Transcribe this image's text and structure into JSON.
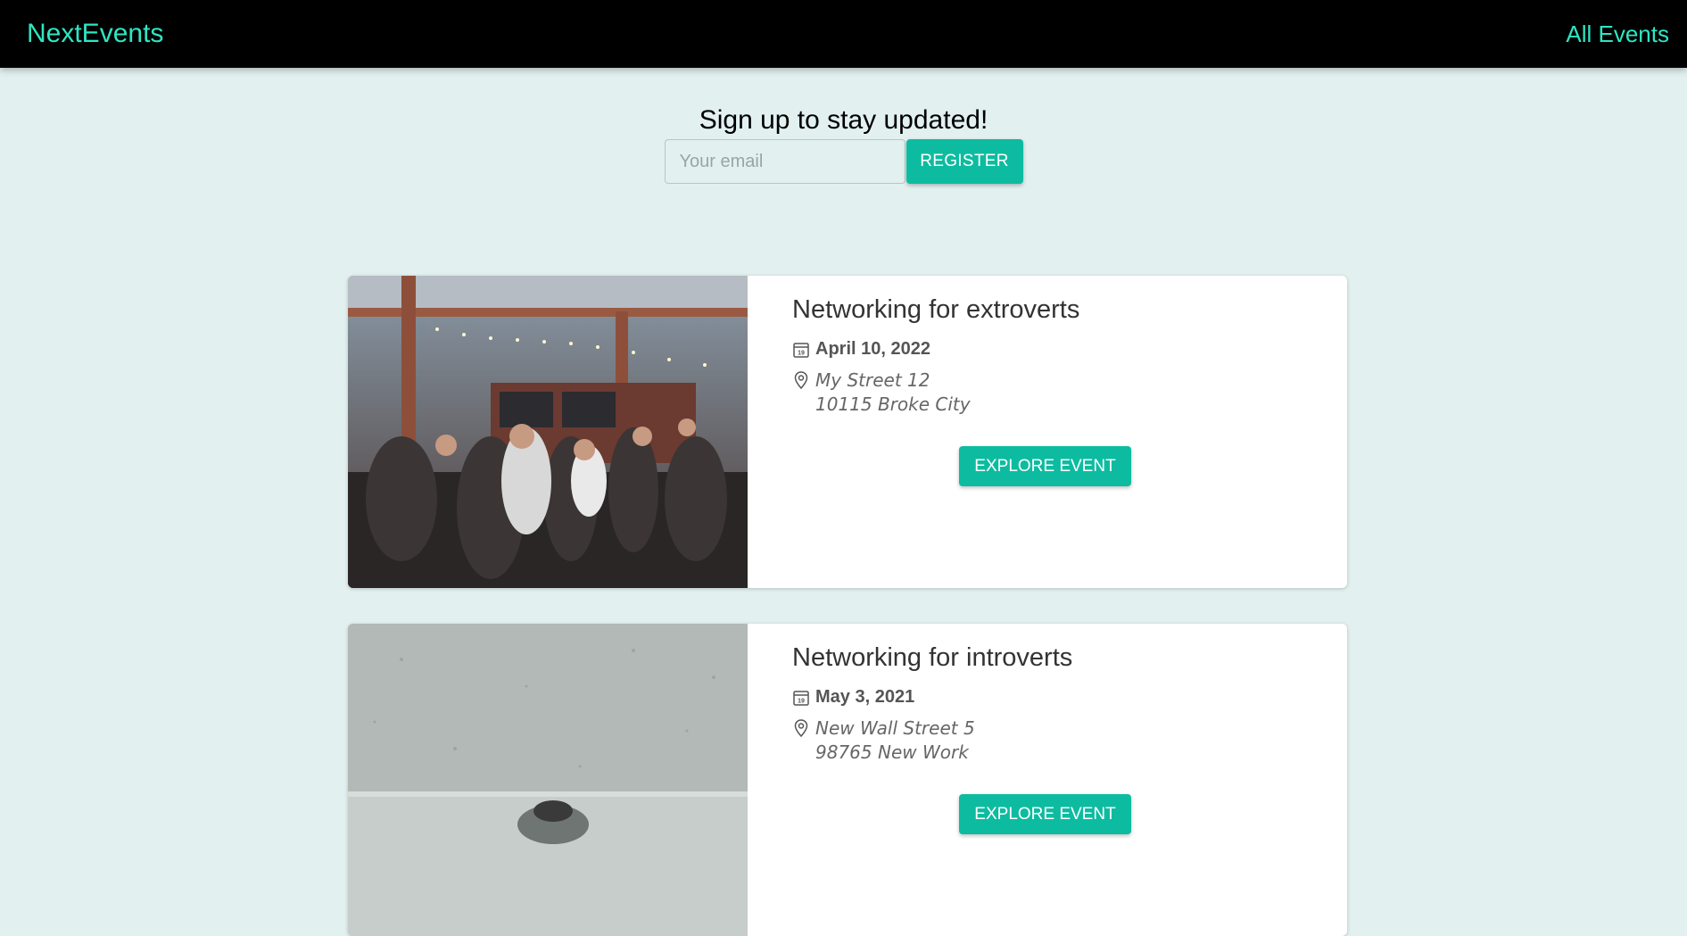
{
  "header": {
    "logo": "NextEvents",
    "nav_all_events": "All Events"
  },
  "signup": {
    "title": "Sign up to stay updated!",
    "email_placeholder": "Your email",
    "register_label": "REGISTER"
  },
  "events": [
    {
      "title": "Networking for extroverts",
      "date": "April 10, 2022",
      "address_line1": "My Street 12",
      "address_line2": "10115 Broke City",
      "button_label": "EXPLORE EVENT",
      "calendar_icon_day": "19"
    },
    {
      "title": "Networking for introverts",
      "date": "May 3, 2021",
      "address_line1": "New Wall Street 5",
      "address_line2": "98765 New Work",
      "button_label": "EXPLORE EVENT",
      "calendar_icon_day": "19"
    }
  ],
  "colors": {
    "brand": "#2ee6c3",
    "accent_button": "#0dbca0",
    "page_background": "#e2f0f0",
    "header_background": "#000000"
  }
}
